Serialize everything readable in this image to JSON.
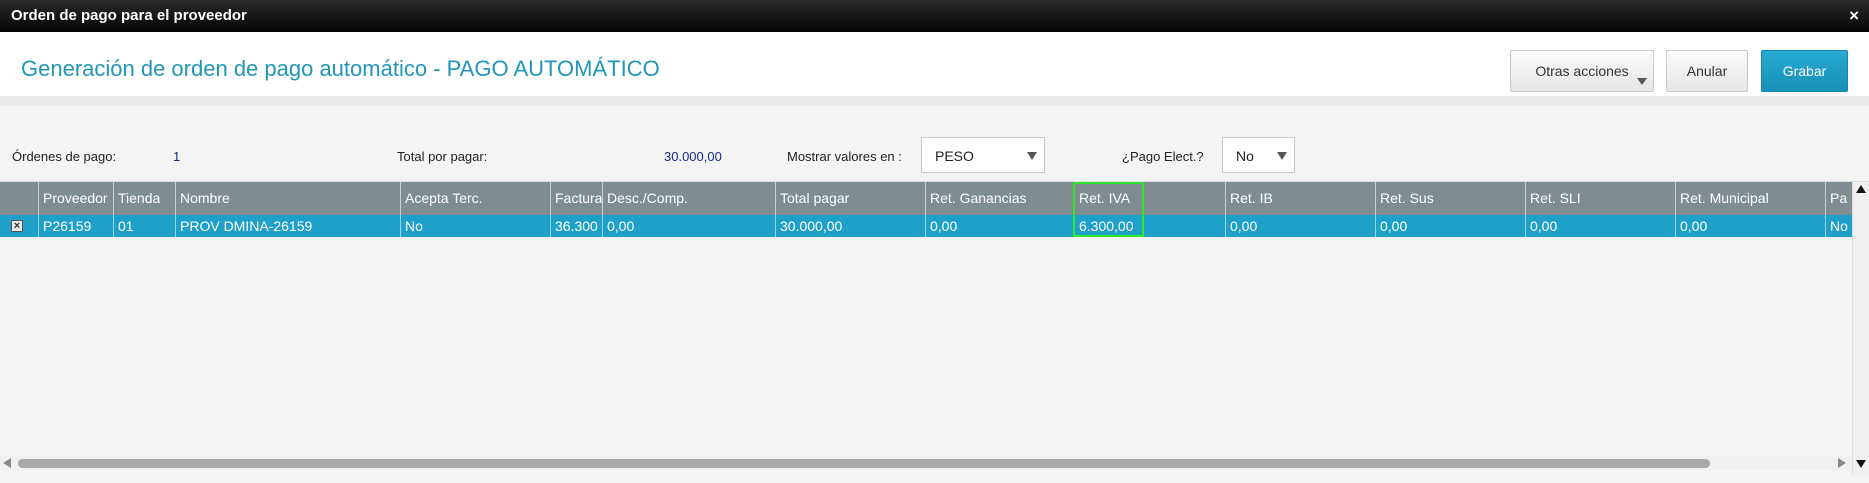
{
  "window": {
    "title": "Orden de pago para el proveedor",
    "close_glyph": "×"
  },
  "header": {
    "title": "Generación de orden de pago automático - PAGO AUTOMÁTICO",
    "buttons": {
      "otras_acciones": "Otras acciones",
      "anular": "Anular",
      "grabar": "Grabar"
    }
  },
  "summary": {
    "ordenes_label": "Órdenes de pago:",
    "ordenes_value": "1",
    "total_label": "Total por pagar:",
    "total_value": "30.000,00",
    "mostrar_label": "Mostrar valores en :",
    "mostrar_value": "PESO",
    "pago_elect_label": "¿Pago Elect.?",
    "pago_elect_value": "No"
  },
  "grid": {
    "columns": [
      "Proveedor",
      "Tienda",
      "Nombre",
      "Acepta Terc.",
      "Factura",
      "Desc./Comp.",
      "Total pagar",
      "Ret. Ganancias",
      "Ret. IVA",
      "Ret. IB",
      "Ret. Sus",
      "Ret. SLI",
      "Ret. Municipal",
      "Pa"
    ],
    "rows": [
      {
        "checkbox": "×",
        "cells": [
          "P26159",
          "01",
          "PROV DMINA-26159",
          "No",
          "36.300",
          "0,00",
          "30.000,00",
          "0,00",
          "6.300,00",
          "0,00",
          "0,00",
          "0,00",
          "0,00",
          "No"
        ]
      }
    ]
  },
  "colors": {
    "accent": "#2196b8",
    "header_grid": "#7f8d92",
    "selected_row": "#1fa0c8",
    "highlight": "#2ee62e"
  }
}
